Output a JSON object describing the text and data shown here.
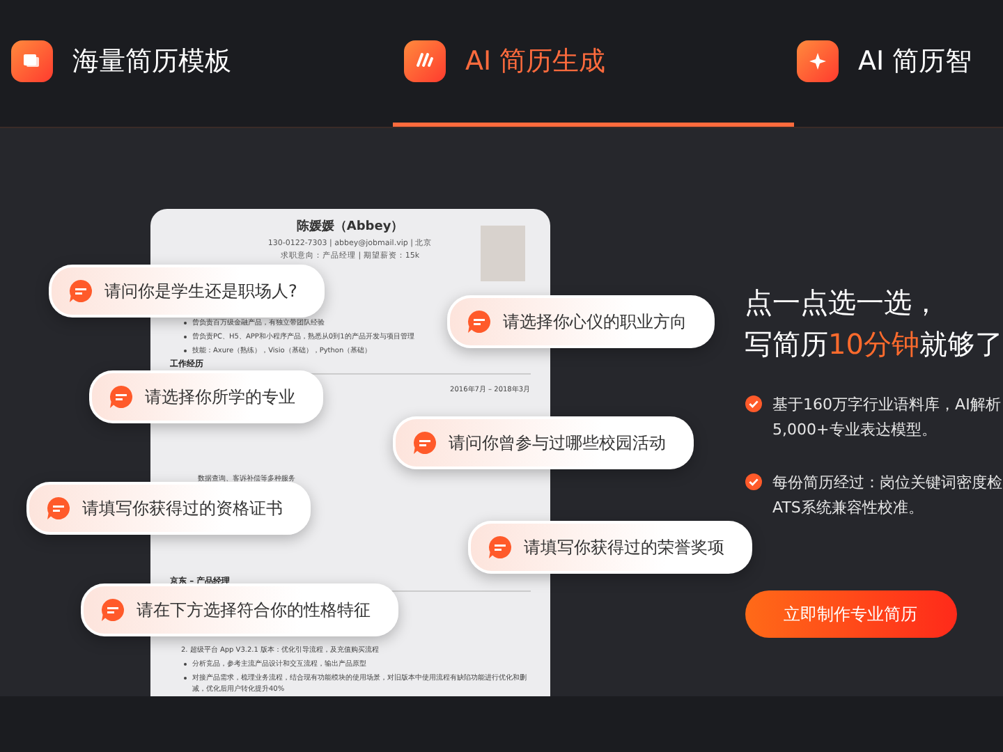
{
  "tabs": [
    {
      "label": "海量简历模板",
      "selected": false
    },
    {
      "label": "AI 简历生成",
      "selected": true
    },
    {
      "label": "AI 简历智",
      "selected": false
    }
  ],
  "resume": {
    "name": "陈媛媛（Abbey）",
    "contact": "130-0122-7303 | abbey@jobmail.vip | 北京",
    "intent": "求职意向：产品经理 | 期望薪资：15k",
    "lines": [
      {
        "kind": "bullet",
        "text": "曾负责百万级金融产品，有独立带团队经验"
      },
      {
        "kind": "bullet",
        "text": "曾负责PC、H5、APP和小程序产品，熟悉从0到1的产品开发与项目管理"
      },
      {
        "kind": "bullet",
        "text": "技能：Axure（熟练），Visio（基础），Python（基础）"
      },
      {
        "kind": "heading",
        "text": "工作经历"
      },
      {
        "kind": "date",
        "text": "2016年7月 – 2018年3月"
      },
      {
        "kind": "plain",
        "text": "数据查询、客诉补偿等多种服务"
      },
      {
        "kind": "heading",
        "text": "京东 – 产品经理"
      },
      {
        "kind": "numbered",
        "text": "2. 超级平台 App V3.2.1 版本：优化引导流程，及充值购买流程"
      },
      {
        "kind": "bullet",
        "text": "分析竞品，参考主流产品设计和交互流程，输出产品原型"
      },
      {
        "kind": "bullet",
        "text": "对接产品需求，梳理业务流程，结合现有功能模块的使用场景，对旧版本中使用流程有缺陷功能进行优化和删减，优化后用户转化提升40%"
      }
    ]
  },
  "prompts": [
    "请问你是学生还是职场人?",
    "请选择你心仪的职业方向",
    "请选择你所学的专业",
    "请问你曾参与过哪些校园活动",
    "请填写你获得过的资格证书",
    "请填写你获得过的荣誉奖项",
    "请在下方选择符合你的性格特征"
  ],
  "headline": {
    "line1": "点一点选一选，",
    "line2_before": "写简历",
    "line2_highlight": "10分钟",
    "line2_after": "就够了"
  },
  "features": [
    {
      "lines": [
        "基于160万字行业语料库，AI解析",
        "5,000+专业表达模型。"
      ]
    },
    {
      "lines": [
        "每份简历经过：岗位关键词密度检",
        "ATS系统兼容性校准。"
      ]
    }
  ],
  "cta": "立即制作专业简历"
}
